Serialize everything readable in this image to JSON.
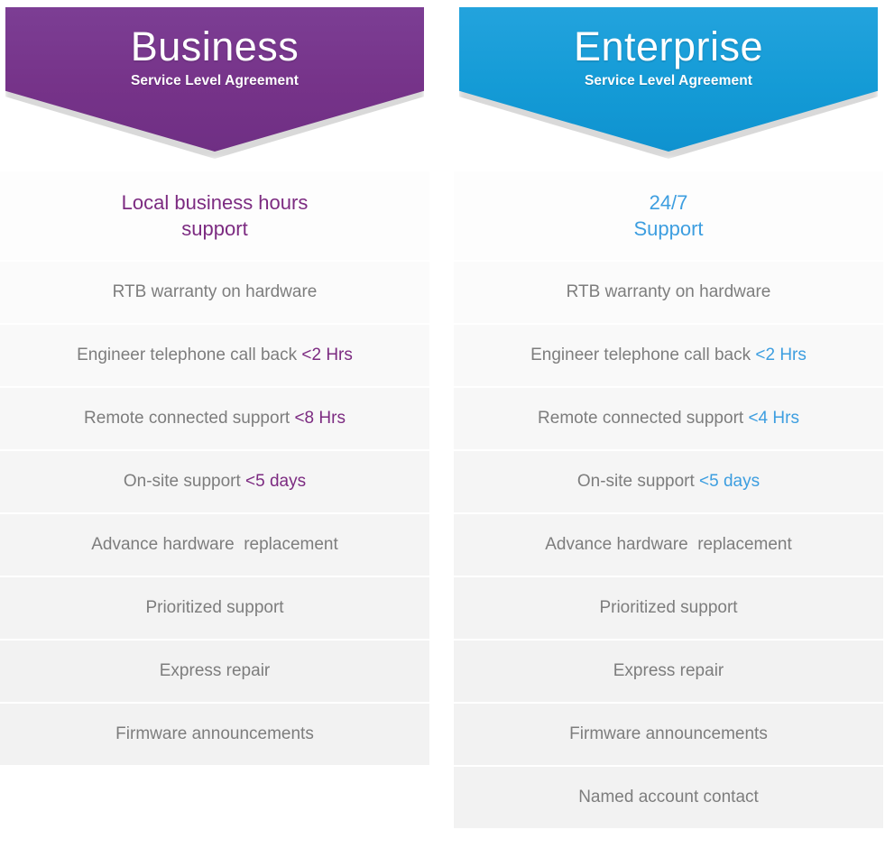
{
  "plans": [
    {
      "id": "business",
      "accent_color": "#77338f",
      "accent_text_color": "#7c2b81",
      "banner": {
        "title": "Business",
        "subtitle": "Service Level Agreement"
      },
      "headline": "Local business hours\nsupport",
      "features": [
        {
          "text": "RTB warranty on hardware",
          "highlight": ""
        },
        {
          "text": "Engineer telephone call back ",
          "highlight": "<2 Hrs"
        },
        {
          "text": "Remote connected support ",
          "highlight": "<8 Hrs"
        },
        {
          "text": "On-site support ",
          "highlight": "<5 days"
        },
        {
          "text": "Advance hardware  replacement",
          "highlight": ""
        },
        {
          "text": "Prioritized support",
          "highlight": ""
        },
        {
          "text": "Express repair",
          "highlight": ""
        },
        {
          "text": "Firmware announcements",
          "highlight": ""
        }
      ]
    },
    {
      "id": "enterprise",
      "accent_color": "#1a9ad4",
      "accent_text_color": "#3d9ee0",
      "banner": {
        "title": "Enterprise",
        "subtitle": "Service Level Agreement"
      },
      "headline": "24/7\nSupport",
      "features": [
        {
          "text": "RTB warranty on hardware",
          "highlight": ""
        },
        {
          "text": "Engineer telephone call back ",
          "highlight": "<2 Hrs"
        },
        {
          "text": "Remote connected support ",
          "highlight": "<4 Hrs"
        },
        {
          "text": "On-site support ",
          "highlight": "<5 days"
        },
        {
          "text": "Advance hardware  replacement",
          "highlight": ""
        },
        {
          "text": "Prioritized support",
          "highlight": ""
        },
        {
          "text": "Express repair",
          "highlight": ""
        },
        {
          "text": "Firmware announcements",
          "highlight": ""
        },
        {
          "text": "Named account contact",
          "highlight": ""
        }
      ]
    }
  ]
}
